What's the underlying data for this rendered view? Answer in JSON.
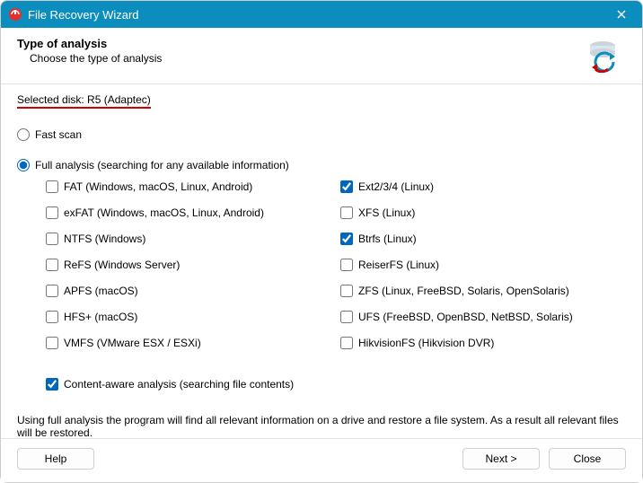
{
  "window": {
    "title": "File Recovery Wizard"
  },
  "header": {
    "title": "Type of analysis",
    "subtitle": "Choose the type of analysis"
  },
  "selected_disk": {
    "label": "Selected disk: R5 (Adaptec)"
  },
  "scan_options": {
    "fast": {
      "label": "Fast scan",
      "selected": false
    },
    "full": {
      "label": "Full analysis (searching for any available information)",
      "selected": true
    }
  },
  "filesystems": {
    "left": [
      {
        "id": "fat",
        "label": "FAT (Windows, macOS, Linux, Android)",
        "checked": false
      },
      {
        "id": "exfat",
        "label": "exFAT (Windows, macOS, Linux, Android)",
        "checked": false
      },
      {
        "id": "ntfs",
        "label": "NTFS (Windows)",
        "checked": false
      },
      {
        "id": "refs",
        "label": "ReFS (Windows Server)",
        "checked": false
      },
      {
        "id": "apfs",
        "label": "APFS (macOS)",
        "checked": false
      },
      {
        "id": "hfs",
        "label": "HFS+ (macOS)",
        "checked": false
      },
      {
        "id": "vmfs",
        "label": "VMFS (VMware ESX / ESXi)",
        "checked": false
      }
    ],
    "right": [
      {
        "id": "ext",
        "label": "Ext2/3/4 (Linux)",
        "checked": true
      },
      {
        "id": "xfs",
        "label": "XFS (Linux)",
        "checked": false
      },
      {
        "id": "btrfs",
        "label": "Btrfs (Linux)",
        "checked": true
      },
      {
        "id": "reiser",
        "label": "ReiserFS (Linux)",
        "checked": false
      },
      {
        "id": "zfs",
        "label": "ZFS (Linux, FreeBSD, Solaris, OpenSolaris)",
        "checked": false
      },
      {
        "id": "ufs",
        "label": "UFS (FreeBSD, OpenBSD, NetBSD, Solaris)",
        "checked": false
      },
      {
        "id": "hikfs",
        "label": "HikvisionFS (Hikvision DVR)",
        "checked": false
      }
    ]
  },
  "content_aware": {
    "label": "Content-aware analysis (searching file contents)",
    "checked": true
  },
  "description": "Using full analysis the program will find all relevant information on a drive and restore a file system. As a result all relevant files will be restored.",
  "buttons": {
    "help": "Help",
    "next": "Next >",
    "close": "Close"
  }
}
